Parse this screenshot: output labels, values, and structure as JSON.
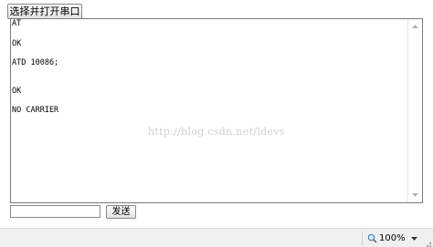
{
  "toolbar": {
    "open_port_label": "选择并打开串口"
  },
  "output": {
    "lines": [
      "AT",
      "OK",
      "ATD 10086;",
      "OK",
      "NO CARRIER"
    ],
    "watermark": "http://blog.csdn.net/ldevs"
  },
  "send": {
    "input_value": "",
    "button_label": "发送"
  },
  "statusbar": {
    "zoom_label": "100%",
    "zoom_icon": "magnifier-icon",
    "dropdown_icon": "chevron-down-icon"
  }
}
